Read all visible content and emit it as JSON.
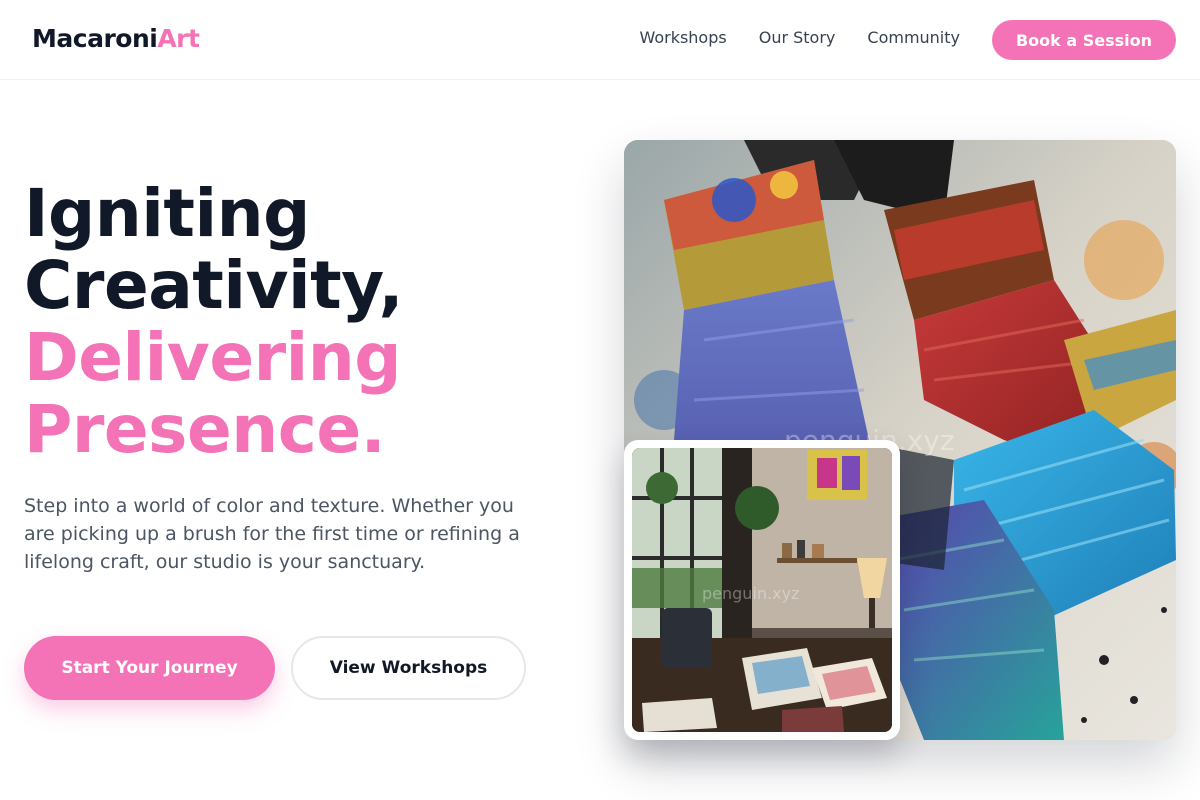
{
  "brand": {
    "name_main": "Macaroni",
    "name_accent": "Art",
    "accent_color": "#f472b6"
  },
  "nav": {
    "links": [
      "Workshops",
      "Our Story",
      "Community"
    ],
    "cta": "Book a Session"
  },
  "hero": {
    "headline": [
      "Igniting",
      "Creativity,",
      "Delivering",
      "Presence."
    ],
    "lead": "Step into a world of color and texture. Whether you are picking up a brush for the first time or refining a lifelong craft, our studio is your sanctuary.",
    "primary_cta": "Start Your Journey",
    "secondary_cta": "View Workshops"
  },
  "images": {
    "main_photo": "paint-brushes-photo",
    "inset_photo": "art-studio-photo",
    "watermark": "penguin.xyz",
    "inset_watermark": "penguin.xyz"
  },
  "colors": {
    "text_dark": "#111827",
    "text_muted": "#4b5563",
    "pink": "#f472b6"
  }
}
